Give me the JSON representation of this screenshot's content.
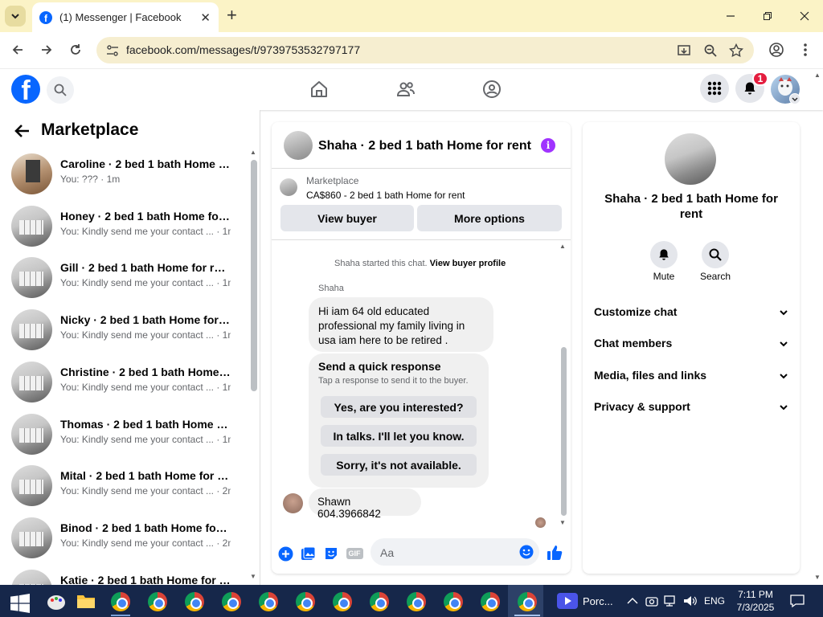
{
  "browser": {
    "tab_title": "(1) Messenger | Facebook",
    "new_tab": "+",
    "url": "facebook.com/messages/t/9739753532797177"
  },
  "fb": {
    "notification_count": "1"
  },
  "left": {
    "title": "Marketplace",
    "conversations": [
      {
        "name": "Caroline · 2 bed 1 bath Home fo...",
        "preview": "You: ??? · 1m"
      },
      {
        "name": "Honey · 2 bed 1 bath Home for r...",
        "preview": "You: Kindly send me your contact ... · 1m"
      },
      {
        "name": "Gill · 2 bed 1 bath Home for rent",
        "preview": "You: Kindly send me your contact ... · 1m"
      },
      {
        "name": "Nicky · 2 bed 1 bath Home for r...",
        "preview": "You: Kindly send me your contact ... · 1m"
      },
      {
        "name": "Christine · 2 bed 1 bath Home fo...",
        "preview": "You: Kindly send me your contact ... · 1m"
      },
      {
        "name": "Thomas · 2 bed 1 bath Home for...",
        "preview": "You: Kindly send me your contact ... · 1m"
      },
      {
        "name": "Mital · 2 bed 1 bath Home for rent",
        "preview": "You: Kindly send me your contact ... · 2m"
      },
      {
        "name": "Binod · 2 bed 1 bath Home for r...",
        "preview": "You: Kindly send me your contact ... · 2m"
      },
      {
        "name": "Katie · 2 bed 1 bath Home for rent",
        "preview": ""
      }
    ]
  },
  "chat": {
    "title": "Shaha · 2 bed 1 bath Home for rent",
    "listing_label": "Marketplace",
    "listing_price": "CA$860 - 2 bed 1 bath Home for rent",
    "view_buyer": "View buyer",
    "more_options": "More options",
    "start_note": "Shaha started this chat.",
    "view_buyer_profile": "View buyer profile",
    "sender": "Shaha",
    "message1": "Hi iam 64 old educated professional my family living in usa iam here to be retired .",
    "quick_title": "Send a quick response",
    "quick_sub": "Tap a response to send it to the buyer.",
    "quick_replies": [
      "Yes, are you interested?",
      "In talks. I'll let you know.",
      "Sorry, it's not available."
    ],
    "message2": "Shawn 604.3966842",
    "composer_placeholder": "Aa",
    "gif": "GIF"
  },
  "right": {
    "name": "Shaha · 2 bed 1 bath Home for rent",
    "mute": "Mute",
    "search": "Search",
    "sections": [
      "Customize chat",
      "Chat members",
      "Media, files and links",
      "Privacy & support"
    ]
  },
  "taskbar": {
    "app_label": "Porc...",
    "lang": "ENG",
    "time": "7:11 PM",
    "date": "7/3/2025"
  },
  "colors": {
    "fb_blue": "#0866ff",
    "info_purple": "#a033ff",
    "badge_red": "#e41e3f",
    "titlebar": "#fbf3c6",
    "taskbar": "#16274a"
  }
}
